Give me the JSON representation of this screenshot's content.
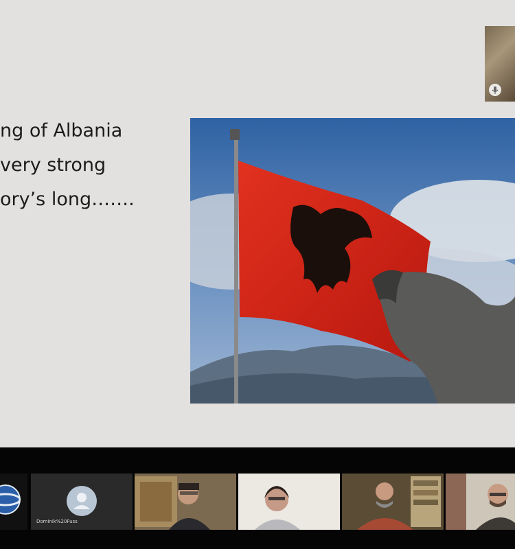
{
  "slide": {
    "lines": [
      "ng of Albania",
      "very strong",
      "ory’s long……."
    ]
  },
  "self_view": {
    "mic_icon": "mic-icon"
  },
  "photo": {
    "subject": "albanian-flag-and-statue"
  },
  "filmstrip": {
    "participants": [
      {
        "label": ""
      },
      {
        "label": "Dominik%20Fuss"
      },
      {
        "label": ""
      },
      {
        "label": ""
      },
      {
        "label": ""
      },
      {
        "label": ""
      }
    ]
  },
  "colors": {
    "slide_bg": "#e2e1e0",
    "flag_red": "#d8271c",
    "sky_blue": "#3d6fae",
    "strip_bg": "#050505"
  }
}
